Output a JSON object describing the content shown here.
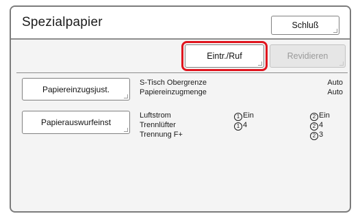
{
  "header": {
    "title": "Spezialpapier",
    "close_label": "Schluß"
  },
  "toolbar": {
    "entry_label": "Eintr./Ruf",
    "revise_label": "Revidieren"
  },
  "feed_section": {
    "button_label": "Papiereinzugsjust.",
    "rows": [
      {
        "label": "S-Tisch Obergrenze",
        "value": "Auto"
      },
      {
        "label": "Papiereinzugmenge",
        "value": "Auto"
      }
    ]
  },
  "output_section": {
    "button_label": "Papierauswurfeinst",
    "rows": [
      {
        "label": "Luftstrom",
        "col1_num": "1",
        "col1_val": "Ein",
        "col2_num": "2",
        "col2_val": "Ein"
      },
      {
        "label": "Trennlüfter",
        "col1_num": "1",
        "col1_val": "4",
        "col2_num": "2",
        "col2_val": "4"
      },
      {
        "label": "Trennung F+",
        "col2_num": "2",
        "col2_val": "3"
      }
    ]
  },
  "colors": {
    "highlight": "#e0141e",
    "frame": "#7a7a7a",
    "panel_background": "#f4f4f4"
  }
}
